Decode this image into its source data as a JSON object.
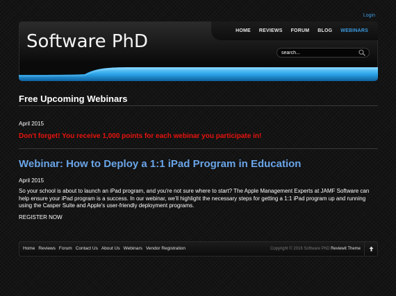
{
  "header": {
    "login": "Login",
    "site_name": "Software PhD",
    "nav": [
      {
        "label": "HOME"
      },
      {
        "label": "REVIEWS"
      },
      {
        "label": "FORUM"
      },
      {
        "label": "BLOG"
      },
      {
        "label": "WEBINARS",
        "active": true
      }
    ],
    "search_placeholder": "search..."
  },
  "main": {
    "page_title": "Free Upcoming Webinars",
    "date_1": "April 2015",
    "reminder": "Don't forget! You receive 1,000 points for each webinar you participate in!",
    "webinar_title": "Webinar: How to Deploy a 1:1 iPad Program in Education",
    "date_2": "April 2015",
    "description": "So your school is about to launch an iPad program, and you're not sure where to start? The Apple Management Experts at JAMF Software can help ensure your iPad program is a success. In our webinar, we'll highlight the necessary steps for getting a 1:1 iPad program up and running using the Casper Suite and Apple's user-friendly deployment programs.",
    "register": "REGISTER NOW"
  },
  "footer": {
    "links": [
      "Home",
      "Reviews",
      "Forum",
      "Contact Us",
      "About Us",
      "Webinars",
      "Vendor Registration"
    ],
    "copyright": "Copyright © 2016 Software PhD",
    "theme": "Reviewit Theme",
    "back_to_top_icon": "arrow-up-icon"
  },
  "colors": {
    "accent_blue": "#3a9be0",
    "webinar_link": "#6aa5e8",
    "reminder_red": "#e8130d",
    "background": "#141414"
  }
}
